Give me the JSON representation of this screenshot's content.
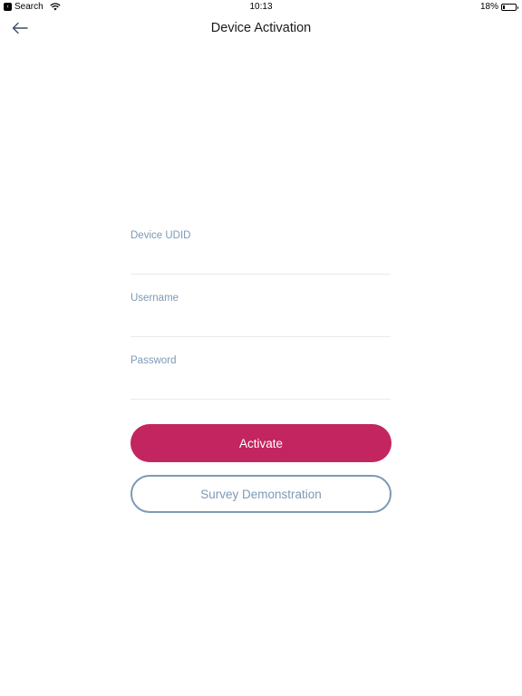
{
  "status_bar": {
    "back_app_label": "Search",
    "time": "10:13",
    "battery_percent": "18%",
    "battery_level": 0.18
  },
  "nav": {
    "title": "Device Activation",
    "back_icon": "arrow-left-icon"
  },
  "form": {
    "udid_label": "Device UDID",
    "udid_value": "",
    "username_label": "Username",
    "username_value": "",
    "password_label": "Password",
    "password_value": ""
  },
  "buttons": {
    "activate_label": "Activate",
    "survey_label": "Survey Demonstration"
  },
  "colors": {
    "accent": "#c2255f",
    "secondary": "#7d9ab5",
    "divider": "#ebebeb"
  }
}
